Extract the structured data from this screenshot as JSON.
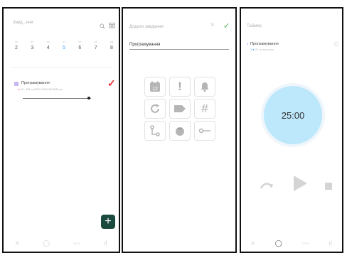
{
  "panel1": {
    "header": "Завд...ння",
    "days": [
      {
        "dow": "пн",
        "num": "2"
      },
      {
        "dow": "вт",
        "num": "3"
      },
      {
        "dow": "ср",
        "num": "4"
      },
      {
        "dow": "чт",
        "num": "5"
      },
      {
        "dow": "пт",
        "num": "6"
      },
      {
        "dow": "сб",
        "num": "7"
      },
      {
        "dow": "нд",
        "num": "8"
      }
    ],
    "active_day_index": 3,
    "task": {
      "title": "Програмування",
      "star": "★",
      "meta": "12 - 503 хв  5/210   100%  3d21698 хв",
      "progress": 0.95
    },
    "fab_label": "+",
    "tabs": [
      "≡",
      "◯",
      "〰",
      "ıl"
    ]
  },
  "panel2": {
    "header": "Додати завдання",
    "close": "×",
    "confirm": "✓",
    "task_name": "Програмування",
    "options": [
      "calendar-icon",
      "priority-icon",
      "bell-icon",
      "repeat-icon",
      "tag-icon",
      "hashtag-icon",
      "subtask-icon",
      "pomodoro-icon",
      "link-icon"
    ],
    "calendar_day": "12",
    "priority_glyph": "!",
    "hash_glyph": "#"
  },
  "panel3": {
    "header": "Таймер",
    "task_title": "Програмування",
    "task_sub_mark": "1 ●",
    "task_sub": "25 хв вагалом",
    "timer": "25:00",
    "accent": "#bde8fb"
  },
  "colors": {
    "accent_blue": "#3aa6ff",
    "red": "#f03232",
    "green": "#4caf50",
    "fab": "#1b4a3e"
  }
}
